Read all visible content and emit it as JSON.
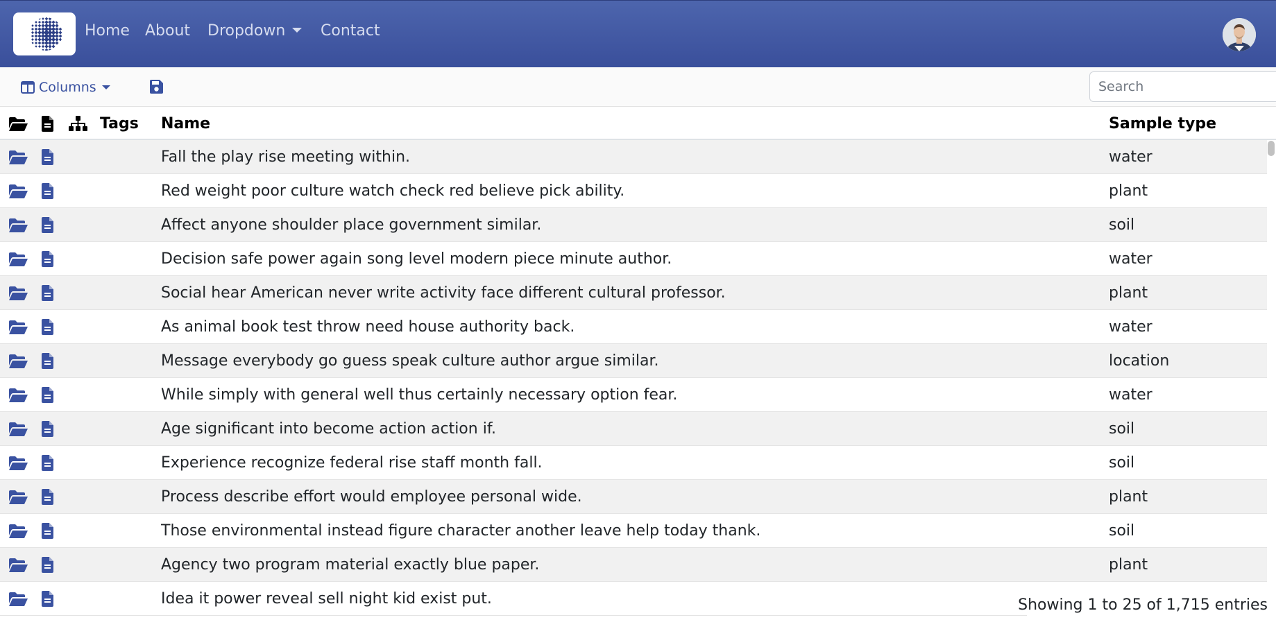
{
  "navbar": {
    "logo_icon": "globe-grid-logo",
    "links": [
      {
        "label": "Home"
      },
      {
        "label": "About"
      },
      {
        "label": "Dropdown"
      },
      {
        "label": "Contact"
      }
    ],
    "avatar_icon": "user-avatar",
    "background_color": "#4258a5",
    "link_color": "#d6dcef"
  },
  "toolbar": {
    "columns_label": "Columns",
    "columns_icon": "columns-icon",
    "save_icon": "floppy-disk-icon",
    "search_placeholder": "Search",
    "accent_color": "#3a52a1"
  },
  "table": {
    "headers": {
      "folder_icon": "folder-open-icon",
      "file_icon": "file-icon",
      "hierarchy_icon": "sitemap-icon",
      "tags": "Tags",
      "name": "Name",
      "sample_type": "Sample type"
    },
    "rows": [
      {
        "name": "Fall the play rise meeting within.",
        "sample_type": "water"
      },
      {
        "name": "Red weight poor culture watch check red believe pick ability.",
        "sample_type": "plant"
      },
      {
        "name": "Affect anyone shoulder place government similar.",
        "sample_type": "soil"
      },
      {
        "name": "Decision safe power again song level modern piece minute author.",
        "sample_type": "water"
      },
      {
        "name": "Social hear American never write activity face different cultural professor.",
        "sample_type": "plant"
      },
      {
        "name": "As animal book test throw need house authority back.",
        "sample_type": "water"
      },
      {
        "name": "Message everybody go guess speak culture author argue similar.",
        "sample_type": "location"
      },
      {
        "name": "While simply with general well thus certainly necessary option fear.",
        "sample_type": "water"
      },
      {
        "name": "Age significant into become action action if.",
        "sample_type": "soil"
      },
      {
        "name": "Experience recognize federal rise staff month fall.",
        "sample_type": "soil"
      },
      {
        "name": "Process describe effort would employee personal wide.",
        "sample_type": "plant"
      },
      {
        "name": "Those environmental instead figure character another leave help today thank.",
        "sample_type": "soil"
      },
      {
        "name": "Agency two program material exactly blue paper.",
        "sample_type": "plant"
      },
      {
        "name": "Idea it power reveal sell night kid exist put.",
        "sample_type": ""
      }
    ]
  },
  "footer": {
    "info": "Showing 1 to 25 of 1,715 entries"
  }
}
